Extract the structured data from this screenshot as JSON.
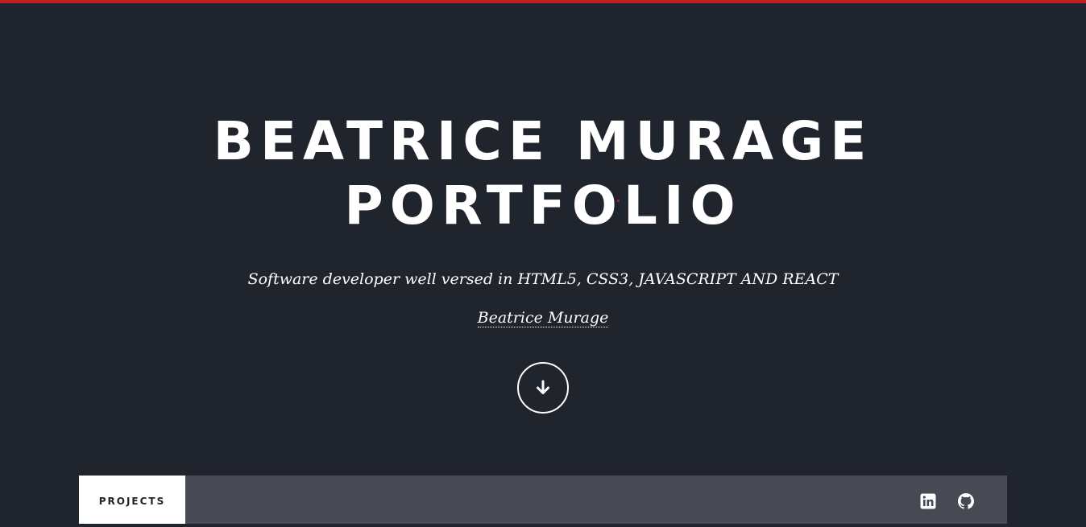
{
  "hero": {
    "title_line1": "BEATRICE MURAGE",
    "title_line2": "PORTFOLIO",
    "tagline": "Software developer well versed in HTML5, CSS3, JAVASCRIPT AND REACT",
    "author": "Beatrice Murage",
    "scroll_icon": "arrow-down-icon"
  },
  "nav": {
    "tabs": [
      {
        "label": "PROJECTS",
        "active": true
      }
    ],
    "social": [
      {
        "icon": "linkedin-icon"
      },
      {
        "icon": "github-icon"
      }
    ]
  },
  "colors": {
    "background": "#20242c",
    "accent": "#c41e24",
    "nav_background": "#474a52",
    "text": "#ffffff"
  }
}
